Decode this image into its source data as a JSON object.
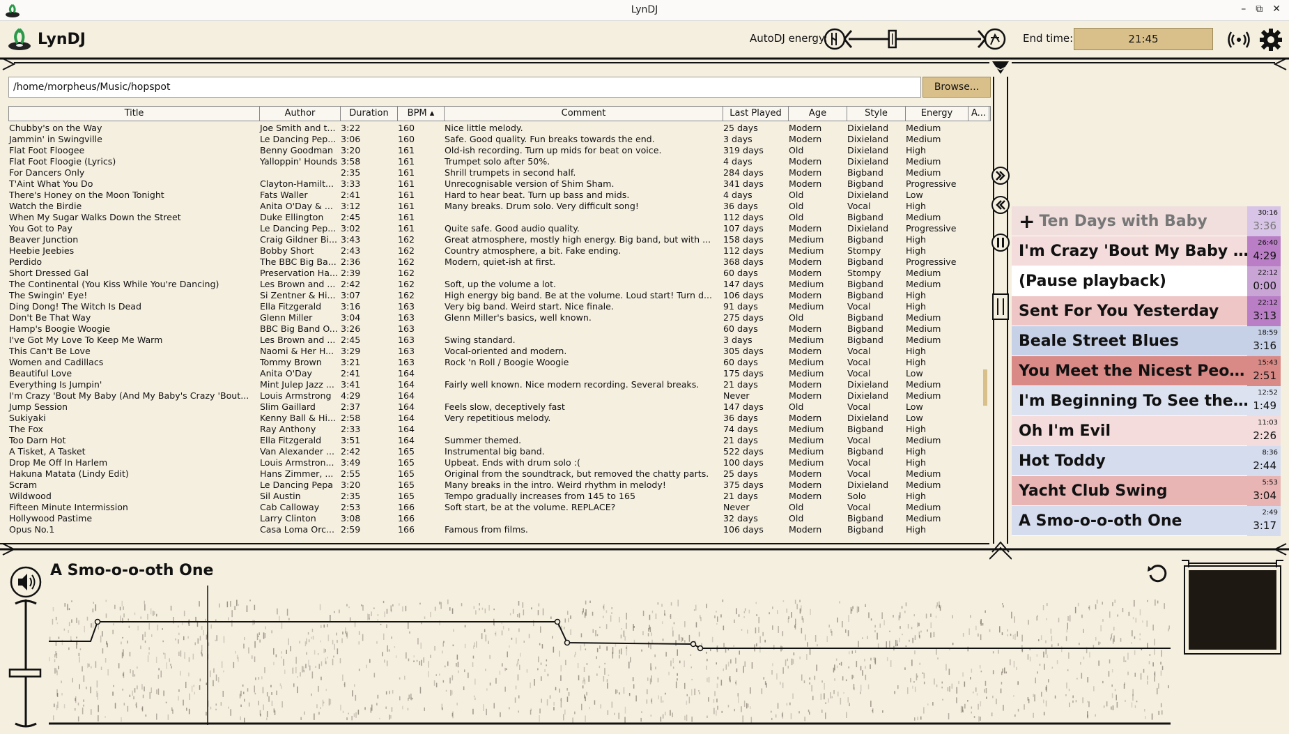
{
  "window": {
    "title": "LynDJ",
    "controls": [
      "–",
      "⧉",
      "✕"
    ]
  },
  "header": {
    "app_name": "LynDJ",
    "autodj_label": "AutoDJ energy:",
    "autodj_level": 0.33,
    "endtime_label": "End time:",
    "endtime_value": "21:45"
  },
  "browser": {
    "path": "/home/morpheus/Music/hopspot",
    "browse_label": "Browse..."
  },
  "table": {
    "columns": [
      "Title",
      "Author",
      "Duration",
      "BPM ▴",
      "Comment",
      "Last Played",
      "Age",
      "Style",
      "Energy",
      "A..."
    ],
    "rows": [
      [
        "Chubby's on the Way",
        "Joe Smith and t...",
        "3:22",
        "160",
        "Nice little melody.",
        "25 days",
        "Modern",
        "Dixieland",
        "Medium"
      ],
      [
        "Jammin' in Swingville",
        "Le Dancing Pep...",
        "3:06",
        "160",
        "Safe. Good quality. Fun breaks towards the end.",
        "3 days",
        "Modern",
        "Dixieland",
        "Medium"
      ],
      [
        "Flat Foot Floogee",
        "Benny Goodman",
        "3:20",
        "161",
        "Old-ish recording. Turn up mids for beat on voice.",
        "319 days",
        "Old",
        "Dixieland",
        "High"
      ],
      [
        "Flat Foot Floogie (Lyrics)",
        "Yalloppin' Hounds",
        "3:58",
        "161",
        "Trumpet solo after 50%.",
        "4 days",
        "Modern",
        "Dixieland",
        "Medium"
      ],
      [
        "For Dancers Only",
        "",
        "2:35",
        "161",
        "Shrill trumpets in second half.",
        "284 days",
        "Modern",
        "Bigband",
        "Medium"
      ],
      [
        "T'Aint What You Do",
        "Clayton-Hamilt...",
        "3:33",
        "161",
        "Unrecognisable version of Shim Sham.",
        "341 days",
        "Modern",
        "Bigband",
        "Progressive"
      ],
      [
        "There's Honey on the Moon Tonight",
        "Fats Waller",
        "2:41",
        "161",
        "Hard to hear beat. Turn up bass and mids.",
        "4 days",
        "Old",
        "Dixieland",
        "Low"
      ],
      [
        "Watch the Birdie",
        "Anita O'Day & ...",
        "3:12",
        "161",
        "Many breaks. Drum solo. Very difficult song!",
        "36 days",
        "Old",
        "Vocal",
        "High"
      ],
      [
        "When My Sugar Walks Down the Street",
        "Duke Ellington",
        "2:45",
        "161",
        "",
        "112 days",
        "Old",
        "Bigband",
        "Medium"
      ],
      [
        "You Got to Pay",
        "Le Dancing Pep...",
        "3:02",
        "161",
        "Quite safe. Good audio quality.",
        "107 days",
        "Modern",
        "Dixieland",
        "Progressive"
      ],
      [
        "Beaver Junction",
        "Craig Gildner Bi...",
        "3:43",
        "162",
        "Great atmosphere, mostly high energy. Big band, but with ...",
        "158 days",
        "Medium",
        "Bigband",
        "High"
      ],
      [
        "Heebie Jeebies",
        "Bobby Short",
        "2:43",
        "162",
        "Country atmosphere, a bit. Fake ending.",
        "112 days",
        "Medium",
        "Stompy",
        "High"
      ],
      [
        "Perdido",
        "The BBC Big Ba...",
        "2:36",
        "162",
        "Modern, quiet-ish at first.",
        "368 days",
        "Modern",
        "Bigband",
        "Progressive"
      ],
      [
        "Short Dressed Gal",
        "Preservation Ha...",
        "2:39",
        "162",
        "",
        "60 days",
        "Modern",
        "Stompy",
        "Medium"
      ],
      [
        "The Continental (You Kiss While You're Dancing)",
        "Les Brown and ...",
        "2:42",
        "162",
        "Soft, up the volume a lot.",
        "147 days",
        "Medium",
        "Bigband",
        "Medium"
      ],
      [
        "The Swingin' Eye!",
        "Si Zentner & Hi...",
        "3:07",
        "162",
        "High energy big band. Be at the volume. Loud start! Turn d...",
        "106 days",
        "Modern",
        "Bigband",
        "High"
      ],
      [
        "Ding Dong! The Witch Is Dead",
        "Ella Fitzgerald",
        "3:16",
        "163",
        "Very big band. Weird start. Nice finale.",
        "91 days",
        "Medium",
        "Vocal",
        "High"
      ],
      [
        "Don't Be That Way",
        "Glenn Miller",
        "3:04",
        "163",
        "Glenn Miller's basics, well known.",
        "275 days",
        "Old",
        "Bigband",
        "Medium"
      ],
      [
        "Hamp's Boogie Woogie",
        "BBC Big Band O...",
        "3:26",
        "163",
        "",
        "60 days",
        "Modern",
        "Bigband",
        "Medium"
      ],
      [
        "I've Got My Love To Keep Me Warm",
        "Les Brown and ...",
        "2:45",
        "163",
        "Swing standard.",
        "3 days",
        "Medium",
        "Bigband",
        "Medium"
      ],
      [
        "This Can't Be Love",
        "Naomi & Her H...",
        "3:29",
        "163",
        "Vocal-oriented and modern.",
        "305 days",
        "Modern",
        "Vocal",
        "High"
      ],
      [
        "Women and Cadillacs",
        "Tommy Brown",
        "3:21",
        "163",
        "Rock 'n Roll / Boogie Woogie",
        "60 days",
        "Medium",
        "Vocal",
        "High"
      ],
      [
        "Beautiful Love",
        "Anita O'Day",
        "2:41",
        "164",
        "",
        "175 days",
        "Medium",
        "Vocal",
        "Low"
      ],
      [
        "Everything Is Jumpin'",
        "Mint Julep Jazz ...",
        "3:41",
        "164",
        "Fairly well known. Nice modern recording. Several breaks.",
        "21 days",
        "Modern",
        "Dixieland",
        "Medium"
      ],
      [
        "I'm Crazy 'Bout My Baby (And My Baby's Crazy 'Bout...",
        "Louis Armstrong",
        "4:29",
        "164",
        "",
        "Never",
        "Modern",
        "Dixieland",
        "Medium"
      ],
      [
        "Jump Session",
        "Slim Gaillard",
        "2:37",
        "164",
        "Feels slow, deceptively fast",
        "147 days",
        "Old",
        "Vocal",
        "Low"
      ],
      [
        "Sukiyaki",
        "Kenny Ball & Hi...",
        "2:58",
        "164",
        "Very repetitious melody.",
        "36 days",
        "Modern",
        "Dixieland",
        "Low"
      ],
      [
        "The Fox",
        "Ray Anthony",
        "2:33",
        "164",
        "",
        "74 days",
        "Medium",
        "Bigband",
        "High"
      ],
      [
        "Too Darn Hot",
        "Ella Fitzgerald",
        "3:51",
        "164",
        "Summer themed.",
        "21 days",
        "Medium",
        "Vocal",
        "Medium"
      ],
      [
        "A Tisket, A Tasket",
        "Van Alexander ...",
        "2:42",
        "165",
        "Instrumental big band.",
        "522 days",
        "Medium",
        "Bigband",
        "High"
      ],
      [
        "Drop Me Off In Harlem",
        "Louis Armstron...",
        "3:49",
        "165",
        "Upbeat. Ends with drum solo :(",
        "100 days",
        "Medium",
        "Vocal",
        "High"
      ],
      [
        "Hakuna Matata (Lindy Edit)",
        "Hans Zimmer, ...",
        "2:55",
        "165",
        "Original from the soundtrack, but removed the chatty parts.",
        "25 days",
        "Modern",
        "Vocal",
        "Medium"
      ],
      [
        "Scram",
        "Le Dancing Pepa",
        "3:20",
        "165",
        "Many breaks in the intro. Weird rhythm in melody!",
        "375 days",
        "Modern",
        "Dixieland",
        "Medium"
      ],
      [
        "Wildwood",
        "Sil Austin",
        "2:35",
        "165",
        "Tempo gradually increases from 145 to 165",
        "21 days",
        "Modern",
        "Solo",
        "High"
      ],
      [
        "Fifteen Minute Intermission",
        "Cab Calloway",
        "2:53",
        "166",
        "Soft start, be at the volume. REPLACE?",
        "Never",
        "Old",
        "Vocal",
        "Medium"
      ],
      [
        "Hollywood Pastime",
        "Larry Clinton",
        "3:08",
        "166",
        "",
        "32 days",
        "Old",
        "Bigband",
        "Medium"
      ],
      [
        "Opus No.1",
        "Casa Loma Orc...",
        "2:59",
        "166",
        "Famous from films.",
        "106 days",
        "Modern",
        "Bigband",
        "High"
      ]
    ]
  },
  "queue": [
    {
      "title": "Ten Days with Baby",
      "start": "30:16",
      "duration": "3:36",
      "color": "#f0dfdc",
      "time_color": "#d8c4e6",
      "faded": true,
      "plus": true
    },
    {
      "title": "I'm Crazy 'Bout My Baby (...",
      "start": "26:40",
      "duration": "4:29",
      "color": "#f3dcdb",
      "time_color": "#b97ec5",
      "faded": false,
      "plus": false
    },
    {
      "title": "(Pause playback)",
      "start": "22:12",
      "duration": "0:00",
      "color": "#ffffff",
      "time_color": "#c9a5d6",
      "faded": false,
      "plus": false
    },
    {
      "title": "Sent For You Yesterday",
      "start": "22:12",
      "duration": "3:13",
      "color": "#eec6c6",
      "time_color": "#b97ec5",
      "faded": false,
      "plus": false
    },
    {
      "title": "Beale Street Blues",
      "start": "18:59",
      "duration": "3:16",
      "color": "#c6d0e6",
      "time_color": "#c6d0e6",
      "faded": false,
      "plus": false
    },
    {
      "title": "You Meet the Nicest Peopl...",
      "start": "15:43",
      "duration": "2:51",
      "color": "#d98a86",
      "time_color": "#d98a86",
      "faded": false,
      "plus": false
    },
    {
      "title": "I'm Beginning To See the L...",
      "start": "12:52",
      "duration": "1:49",
      "color": "#dce2f0",
      "time_color": "#dce2f0",
      "faded": false,
      "plus": false
    },
    {
      "title": "Oh I'm Evil",
      "start": "11:03",
      "duration": "2:26",
      "color": "#f3dcdb",
      "time_color": "#f3dcdb",
      "faded": false,
      "plus": false
    },
    {
      "title": "Hot Toddy",
      "start": "8:36",
      "duration": "2:44",
      "color": "#d5dcee",
      "time_color": "#d5dcee",
      "faded": false,
      "plus": false
    },
    {
      "title": "Yacht Club Swing",
      "start": "5:53",
      "duration": "3:04",
      "color": "#e8b4b4",
      "time_color": "#e8b4b4",
      "faded": false,
      "plus": false
    },
    {
      "title": "A Smo-o-o-oth One",
      "start": "2:49",
      "duration": "3:17",
      "color": "#d5dcee",
      "time_color": "#d5dcee",
      "faded": false,
      "plus": false
    }
  ],
  "player": {
    "now_playing": "A Smo-o-o-oth One",
    "volume_level": 0.42
  },
  "colors": {
    "background": "#f5efe0",
    "accent": "#d9c08a",
    "line": "#111111"
  }
}
